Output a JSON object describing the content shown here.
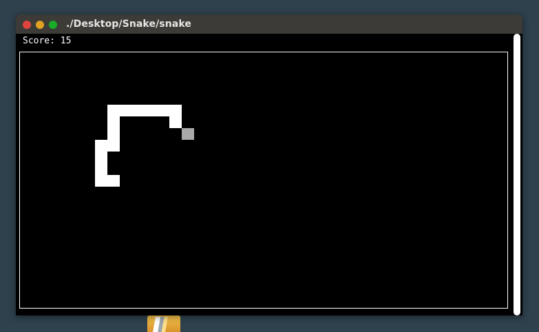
{
  "window": {
    "title": "./Desktop/Snake/snake",
    "controls": {
      "close_color": "#e0443e",
      "minimize_color": "#dea123",
      "maximize_color": "#1aab29"
    }
  },
  "terminal": {
    "score_text": "Score: 15",
    "background": "#000000",
    "foreground": "#ffffff"
  },
  "game": {
    "snake_color": "#ffffff",
    "food_color": "#a9a9a9",
    "snake": [
      [
        7,
        3
      ],
      [
        8,
        3
      ],
      [
        9,
        3
      ],
      [
        10,
        3
      ],
      [
        11,
        3
      ],
      [
        12,
        3
      ],
      [
        12,
        4
      ],
      [
        7,
        4
      ],
      [
        7,
        5
      ],
      [
        7,
        6
      ],
      [
        6,
        6
      ],
      [
        7,
        6
      ],
      [
        6,
        7
      ],
      [
        6,
        8
      ],
      [
        6,
        9
      ],
      [
        7,
        9
      ]
    ],
    "food": [
      13,
      5
    ]
  }
}
